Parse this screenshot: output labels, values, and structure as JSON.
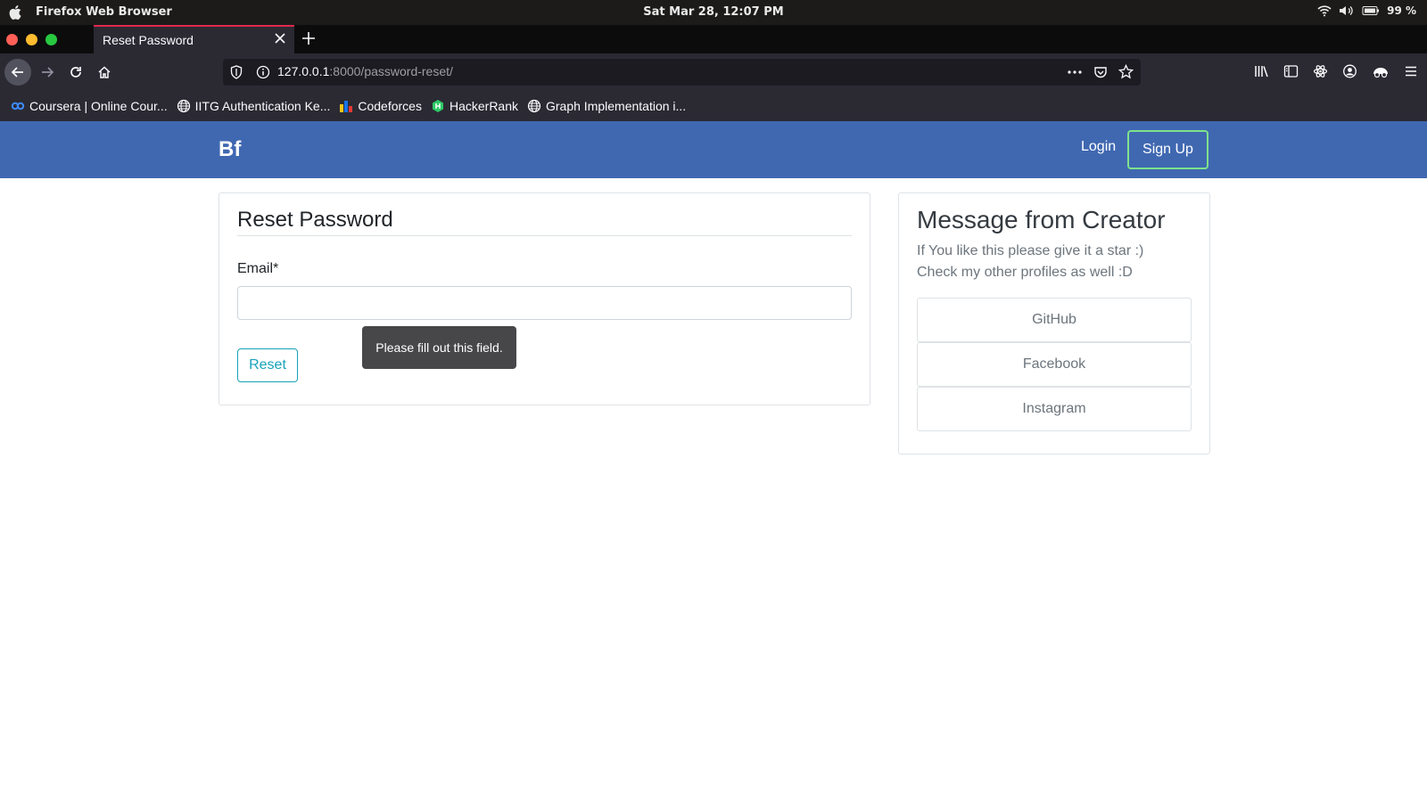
{
  "os": {
    "app_name": "Firefox Web Browser",
    "clock": "Sat Mar 28, 12:07 PM",
    "battery": "99 %"
  },
  "browser": {
    "tab_title": "Reset Password",
    "url_host": "127.0.0.1",
    "url_rest": ":8000/password-reset/"
  },
  "bookmarks": [
    {
      "label": "Coursera | Online Cour...",
      "icon": "coursera-icon"
    },
    {
      "label": "IITG Authentication Ke...",
      "icon": "globe-icon"
    },
    {
      "label": "Codeforces",
      "icon": "codeforces-icon"
    },
    {
      "label": "HackerRank",
      "icon": "hackerrank-icon"
    },
    {
      "label": "Graph Implementation i...",
      "icon": "globe-icon"
    }
  ],
  "site": {
    "brand": "Bf",
    "login": "Login",
    "signup": "Sign Up"
  },
  "reset_card": {
    "title": "Reset Password",
    "email_label": "Email*",
    "email_value": "",
    "submit": "Reset",
    "tooltip": "Please fill out this field."
  },
  "message_card": {
    "title": "Message from Creator",
    "line1": "If You like this please give it a star :)",
    "line2": "Check my other profiles as well :D",
    "links": [
      "GitHub",
      "Facebook",
      "Instagram"
    ]
  },
  "colors": {
    "navbar": "#4068b1",
    "signup_border": "#7ee28a",
    "reset_accent": "#17a2b8",
    "tab_accent": "#e22850"
  }
}
